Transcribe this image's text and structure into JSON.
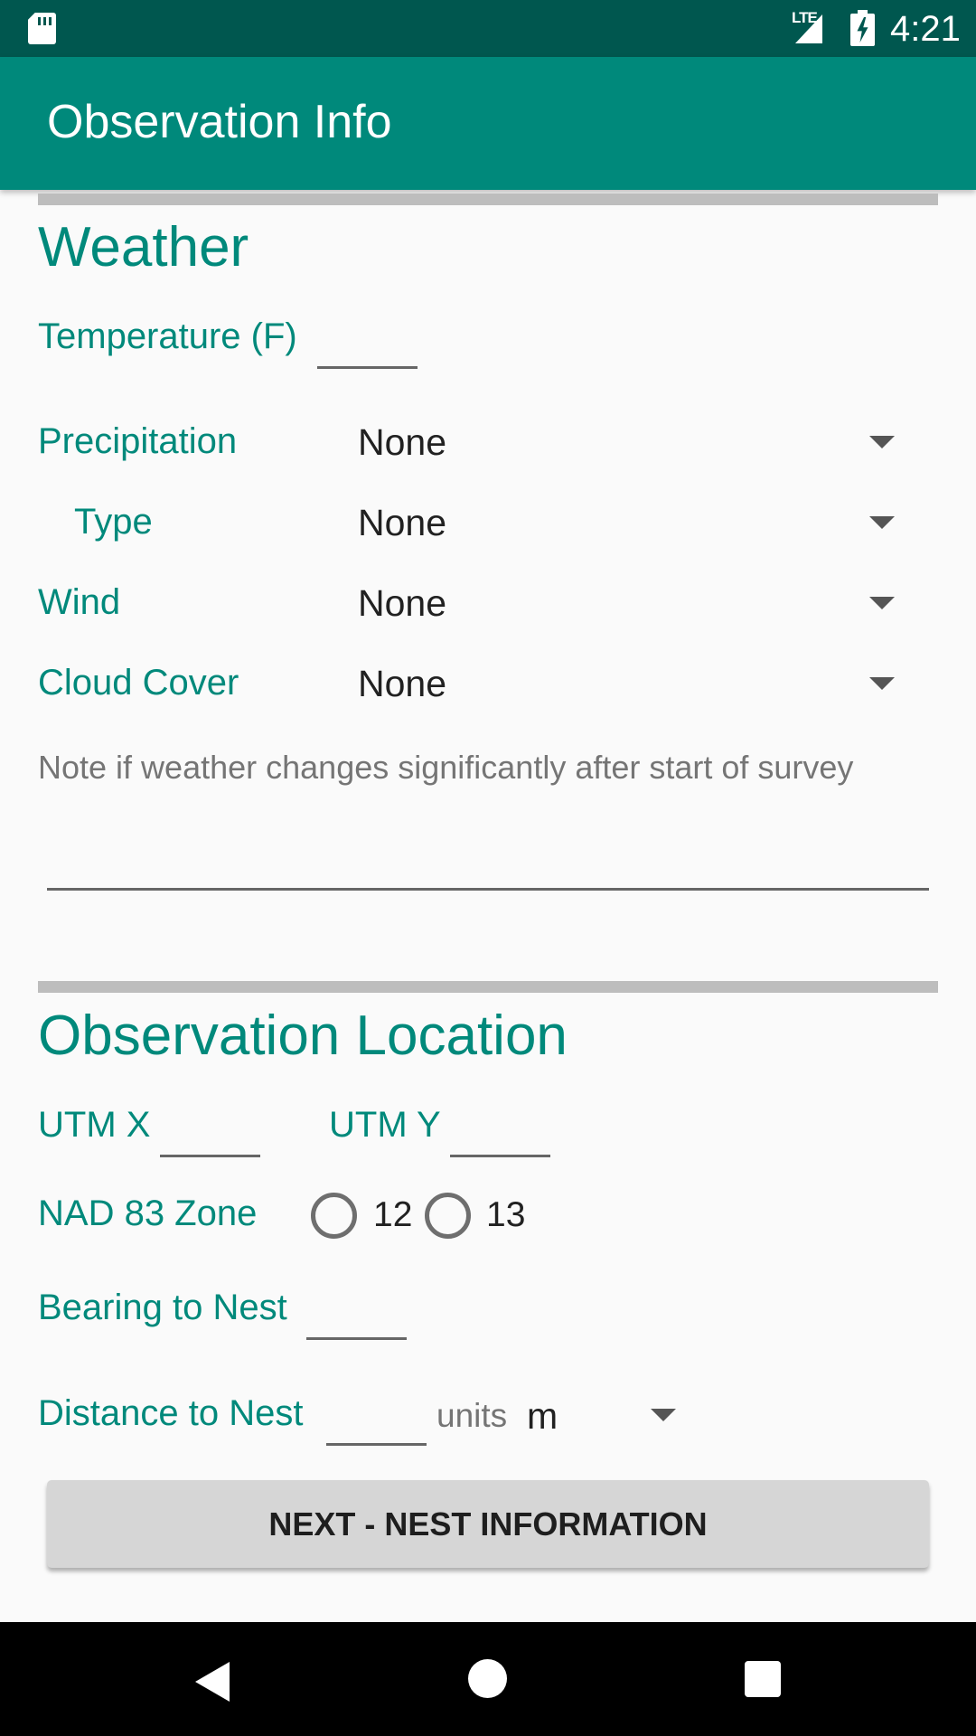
{
  "status_bar": {
    "time": "4:21",
    "network": "LTE"
  },
  "app_bar": {
    "title": "Observation Info"
  },
  "weather": {
    "title": "Weather",
    "temperature_label": "Temperature (F)",
    "temperature_value": "",
    "precipitation": {
      "label": "Precipitation",
      "value": "None"
    },
    "precip_type": {
      "label": "Type",
      "value": "None"
    },
    "wind": {
      "label": "Wind",
      "value": "None"
    },
    "cloud_cover": {
      "label": "Cloud Cover",
      "value": "None"
    },
    "note_hint": "Note if weather changes significantly after start of survey",
    "note_value": ""
  },
  "location": {
    "title": "Observation Location",
    "utm_x_label": "UTM X",
    "utm_y_label": "UTM Y",
    "zone_label": "NAD 83 Zone",
    "zone_options": [
      "12",
      "13"
    ],
    "bearing_label": "Bearing to Nest",
    "distance_label": "Distance to Nest",
    "units_label": "units",
    "units_value": "m"
  },
  "next_button": "NEXT - NEST INFORMATION",
  "colors": {
    "accent": "#00897b",
    "status_bar": "#00574f",
    "divider": "#bdbdbd"
  }
}
